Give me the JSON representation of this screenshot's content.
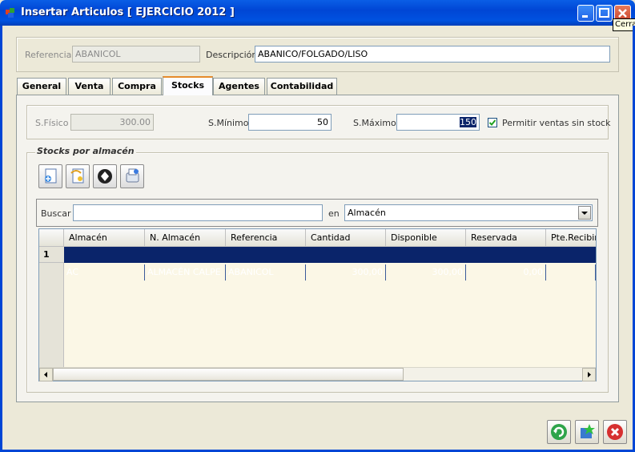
{
  "window": {
    "title": "Insertar Articulos [ EJERCICIO 2012 ]",
    "tooltip": "Cerrar"
  },
  "header": {
    "referencia_label": "Referencia",
    "referencia_value": "ABANICOL",
    "descripcion_label": "Descripción",
    "descripcion_value": "ABANICO/FOLGADO/LISO"
  },
  "tabs": [
    {
      "label": "General"
    },
    {
      "label": "Venta"
    },
    {
      "label": "Compra"
    },
    {
      "label": "Stocks"
    },
    {
      "label": "Agentes"
    },
    {
      "label": "Contabilidad"
    }
  ],
  "stocks": {
    "fisico_label": "S.Físico",
    "fisico_value": "300.00",
    "minimo_label": "S.Mínimo",
    "minimo_value": "50",
    "maximo_label": "S.Máximo",
    "maximo_value": "150",
    "permitir_label": "Permitir ventas sin stock",
    "permitir_checked": true
  },
  "almacen_section": {
    "title": "Stocks por almacén",
    "buscar_label": "Buscar",
    "buscar_value": "",
    "en_label": "en",
    "en_value": "Almacén"
  },
  "grid": {
    "columns": [
      "Almacén",
      "N. Almacén",
      "Referencia",
      "Cantidad",
      "Disponible",
      "Reservada",
      "Pte.Recibir"
    ],
    "rows": [
      {
        "n": "1",
        "cells": [
          "AC",
          "ALMACÉN CALPE",
          "ABANICOL",
          "300,00",
          "300,00",
          "0,00",
          ""
        ]
      }
    ]
  },
  "icons": {
    "toolbar": [
      "new-record-icon",
      "edit-record-icon",
      "delete-record-icon",
      "print-icon"
    ],
    "footer": [
      "refresh-icon",
      "save-icon",
      "cancel-icon"
    ]
  },
  "colors": {
    "titlebar": "#0046d5",
    "selection": "#0a246a",
    "active_tab": "#e68b2c",
    "grid_bg": "#fbf7e6"
  }
}
